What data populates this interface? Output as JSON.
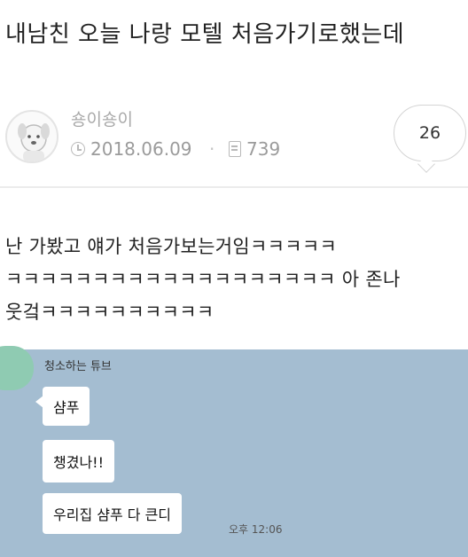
{
  "post": {
    "title": "내남친 오늘 나랑 모텔 처음가기로했는데",
    "author": "숑이숑이",
    "date": "2018.06.09",
    "separator": "·",
    "views": "739",
    "comment_count": "26",
    "body": "난 가봤고 얘가 처음가보는거임ㅋㅋㅋㅋㅋ\nㅋㅋㅋㅋㅋㅋㅋㅋㅋㅋㅋㅋㅋㅋㅋㅋㅋㅋㅋ 아 존나\n웃겈ㅋㅋㅋㅋㅋㅋㅋㅋㅋㅋ"
  },
  "chat": {
    "sender": "청소하는 튜브",
    "messages": [
      "샴푸",
      "챙겼나!!",
      "우리집 샴푸 다 큰디"
    ],
    "time": "오후 12:06"
  }
}
